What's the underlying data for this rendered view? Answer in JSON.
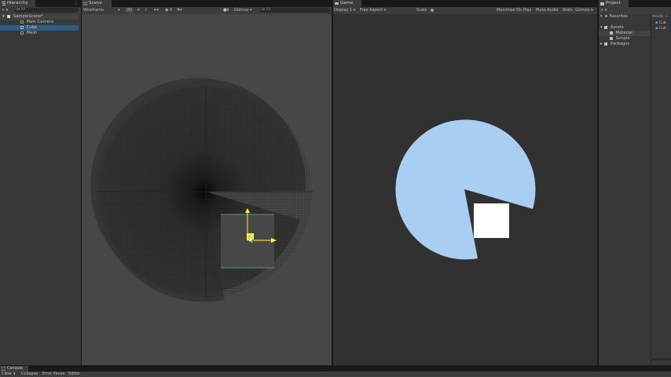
{
  "hierarchy": {
    "tab_label": "Hierarchy",
    "add_label": "+ ▾",
    "search_label": "q▾ All",
    "scene_name": "SampleScene*",
    "items": [
      "Main Camera",
      "Cube",
      "Mesh"
    ]
  },
  "scene": {
    "tab_label": "Scene",
    "shading_mode": "Wireframe",
    "mode_2d": "2D",
    "gizmos": "Gizmos",
    "search": "q▾ All"
  },
  "game": {
    "tab_label": "Game",
    "display": "Display 1",
    "aspect": "Free Aspect",
    "scale_label": "Scale",
    "maximize": "Maximize On Play",
    "mute": "Mute Audio",
    "stats": "Stats",
    "gizmos": "Gizmos"
  },
  "project": {
    "tab_label": "Project",
    "add_label": "+ ▾",
    "favorites": "Favorites",
    "assets": "Assets",
    "folders": [
      "Material",
      "Scripts"
    ],
    "packages": "Packages",
    "breadcrumb": "Assets >",
    "assets_items": [
      "Cub",
      "Cub"
    ]
  },
  "console": {
    "tab_label": "Console",
    "toolbar": [
      "Clear",
      "▾",
      "Collapse",
      "Error Pause",
      "Editor"
    ]
  },
  "colors": {
    "circle": "#a9cef2",
    "cube": "#ffffff",
    "gizmo_y": "#ffff2a",
    "selection": "#2c5d87"
  }
}
